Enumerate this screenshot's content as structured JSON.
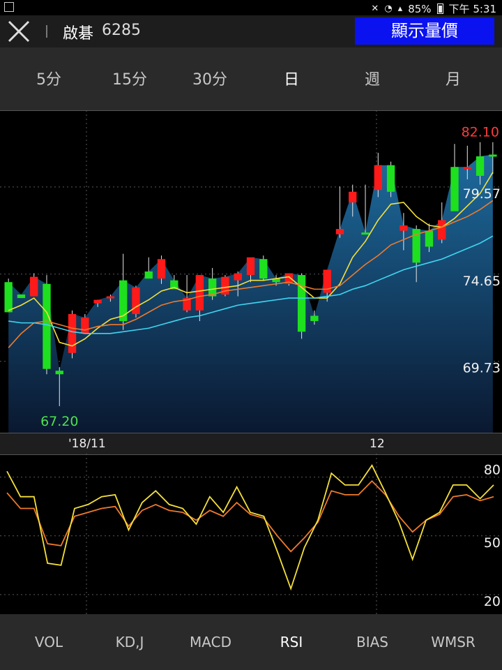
{
  "status": {
    "battery": "85%",
    "time": "下午 5:31"
  },
  "header": {
    "stock_name": "啟碁",
    "stock_code": "6285",
    "quote_button": "顯示量價"
  },
  "periods": [
    {
      "label": "5分",
      "active": false
    },
    {
      "label": "15分",
      "active": false
    },
    {
      "label": "30分",
      "active": false
    },
    {
      "label": "日",
      "active": true
    },
    {
      "label": "週",
      "active": false
    },
    {
      "label": "月",
      "active": false
    }
  ],
  "dates": {
    "left": "'18/11",
    "right": "12"
  },
  "indicators": [
    {
      "label": "VOL",
      "active": false
    },
    {
      "label": "KD,J",
      "active": false
    },
    {
      "label": "MACD",
      "active": false
    },
    {
      "label": "RSI",
      "active": true
    },
    {
      "label": "BIAS",
      "active": false
    },
    {
      "label": "WMSR",
      "active": false
    }
  ],
  "colors": {
    "up": "#ff1a1a",
    "down": "#1ee01e",
    "ma_short": "#f5e03a",
    "ma_mid": "#f07a2a",
    "ma_long": "#3fd6f0",
    "high_label": "#ff3b3b",
    "low_label": "#4ee04e",
    "rsi_fast": "#f5e03a",
    "rsi_slow": "#f07a2a",
    "quote_button": "#0a12f0"
  },
  "chart_data": [
    {
      "type": "candlestick",
      "y_ticks": [
        69.73,
        74.65,
        79.57
      ],
      "ylim": [
        65.7,
        83.9
      ],
      "high_label": "82.10",
      "low_label": "67.20",
      "candles": [
        {
          "o": 74.2,
          "h": 74.4,
          "l": 72.5,
          "c": 72.5
        },
        {
          "o": 73.5,
          "h": 73.5,
          "l": 73.3,
          "c": 73.3
        },
        {
          "o": 73.4,
          "h": 74.7,
          "l": 73.4,
          "c": 74.5
        },
        {
          "o": 74.1,
          "h": 74.6,
          "l": 69.0,
          "c": 69.3
        },
        {
          "o": 69.2,
          "h": 69.4,
          "l": 67.2,
          "c": 69.0
        },
        {
          "o": 70.2,
          "h": 72.6,
          "l": 69.9,
          "c": 72.4
        },
        {
          "o": 71.3,
          "h": 72.4,
          "l": 71.3,
          "c": 72.2
        },
        {
          "o": 73.0,
          "h": 73.2,
          "l": 72.8,
          "c": 73.2
        },
        {
          "o": 73.3,
          "h": 73.5,
          "l": 73.1,
          "c": 73.4
        },
        {
          "o": 74.3,
          "h": 75.8,
          "l": 71.5,
          "c": 72.0
        },
        {
          "o": 72.4,
          "h": 74.0,
          "l": 72.2,
          "c": 73.9
        },
        {
          "o": 74.8,
          "h": 75.6,
          "l": 74.5,
          "c": 74.4
        },
        {
          "o": 74.4,
          "h": 75.7,
          "l": 74.1,
          "c": 75.5
        },
        {
          "o": 74.3,
          "h": 74.6,
          "l": 74.0,
          "c": 73.8
        },
        {
          "o": 72.6,
          "h": 74.6,
          "l": 72.5,
          "c": 73.3
        },
        {
          "o": 72.6,
          "h": 72.7,
          "l": 72.0,
          "c": 74.6
        },
        {
          "o": 74.4,
          "h": 75.0,
          "l": 73.2,
          "c": 73.4
        },
        {
          "o": 73.5,
          "h": 74.6,
          "l": 73.4,
          "c": 74.5
        },
        {
          "o": 74.3,
          "h": 74.8,
          "l": 73.4,
          "c": 74.7
        },
        {
          "o": 74.6,
          "h": 75.0,
          "l": 74.2,
          "c": 75.6
        },
        {
          "o": 75.5,
          "h": 75.7,
          "l": 74.3,
          "c": 74.4
        },
        {
          "o": 74.4,
          "h": 74.6,
          "l": 74.0,
          "c": 74.2
        },
        {
          "o": 74.1,
          "h": 74.7,
          "l": 74.0,
          "c": 74.7
        },
        {
          "o": 74.6,
          "h": 74.7,
          "l": 71.0,
          "c": 71.4
        },
        {
          "o": 72.3,
          "h": 72.6,
          "l": 71.8,
          "c": 72.0
        },
        {
          "o": 73.6,
          "h": 74.7,
          "l": 73.1,
          "c": 74.9
        },
        {
          "o": 76.9,
          "h": 79.6,
          "l": 76.7,
          "c": 77.2
        },
        {
          "o": 78.7,
          "h": 79.7,
          "l": 77.9,
          "c": 79.3
        },
        {
          "o": 77.0,
          "h": 79.7,
          "l": 77.0,
          "c": 76.9
        },
        {
          "o": 79.4,
          "h": 81.5,
          "l": 79.0,
          "c": 80.8
        },
        {
          "o": 80.8,
          "h": 81.0,
          "l": 79.0,
          "c": 79.3
        },
        {
          "o": 77.1,
          "h": 78.1,
          "l": 76.0,
          "c": 77.4
        },
        {
          "o": 77.2,
          "h": 77.4,
          "l": 74.2,
          "c": 75.3
        },
        {
          "o": 77.1,
          "h": 77.5,
          "l": 75.9,
          "c": 76.2
        },
        {
          "o": 76.6,
          "h": 78.7,
          "l": 76.4,
          "c": 77.7
        },
        {
          "o": 80.7,
          "h": 82.0,
          "l": 78.3,
          "c": 78.2
        },
        {
          "o": 80.7,
          "h": 81.9,
          "l": 80.0,
          "c": 80.7
        },
        {
          "o": 81.3,
          "h": 82.1,
          "l": 79.7,
          "c": 80.2
        },
        {
          "o": 81.4,
          "h": 82.1,
          "l": 80.3,
          "c": 81.3
        }
      ],
      "series": [
        {
          "key": "ma_short",
          "values": [
            72.6,
            72.9,
            73.3,
            72.5,
            70.8,
            70.6,
            71.0,
            71.6,
            72.1,
            72.3,
            72.8,
            73.2,
            73.7,
            73.9,
            73.6,
            73.7,
            73.8,
            73.9,
            74.0,
            74.3,
            74.3,
            74.4,
            74.5,
            73.9,
            73.3,
            73.3,
            74.1,
            75.6,
            76.5,
            77.7,
            78.6,
            78.7,
            77.9,
            77.4,
            77.3,
            77.8,
            78.5,
            79.2,
            80.4
          ]
        },
        {
          "key": "ma_mid",
          "values": [
            70.5,
            71.3,
            71.9,
            72.0,
            71.8,
            71.6,
            71.5,
            71.7,
            71.8,
            71.8,
            72.1,
            72.5,
            72.9,
            73.1,
            73.2,
            73.4,
            73.5,
            73.7,
            73.8,
            73.9,
            74.0,
            74.1,
            74.2,
            74.0,
            73.8,
            73.8,
            74.0,
            74.6,
            75.2,
            75.7,
            76.3,
            76.6,
            76.9,
            77.1,
            77.3,
            77.6,
            77.9,
            78.3,
            78.8
          ]
        },
        {
          "key": "ma_long",
          "values": [
            72.0,
            71.9,
            71.9,
            71.8,
            71.6,
            71.4,
            71.3,
            71.3,
            71.3,
            71.4,
            71.5,
            71.6,
            71.8,
            72.0,
            72.2,
            72.3,
            72.5,
            72.7,
            72.9,
            73.0,
            73.1,
            73.2,
            73.3,
            73.3,
            73.3,
            73.4,
            73.5,
            73.8,
            74.0,
            74.3,
            74.6,
            74.9,
            75.1,
            75.3,
            75.5,
            75.8,
            76.1,
            76.4,
            76.8
          ]
        }
      ]
    },
    {
      "type": "line",
      "title": "RSI",
      "y_ticks": [
        20,
        50,
        80
      ],
      "ylim": [
        10,
        92
      ],
      "series": [
        {
          "key": "rsi_fast",
          "values": [
            83,
            70,
            70,
            36,
            35,
            64,
            66,
            70,
            71,
            53,
            67,
            73,
            66,
            64,
            56,
            70,
            62,
            75,
            62,
            60,
            42,
            23,
            44,
            58,
            82,
            76,
            76,
            86,
            72,
            57,
            38,
            58,
            62,
            76,
            76,
            69,
            76
          ]
        },
        {
          "key": "rsi_slow",
          "values": [
            72,
            64,
            64,
            46,
            45,
            60,
            62,
            64,
            65,
            55,
            63,
            66,
            63,
            62,
            58,
            63,
            60,
            67,
            61,
            59,
            50,
            42,
            49,
            57,
            73,
            71,
            71,
            78,
            71,
            60,
            52,
            58,
            61,
            70,
            71,
            68,
            70
          ]
        }
      ]
    }
  ]
}
